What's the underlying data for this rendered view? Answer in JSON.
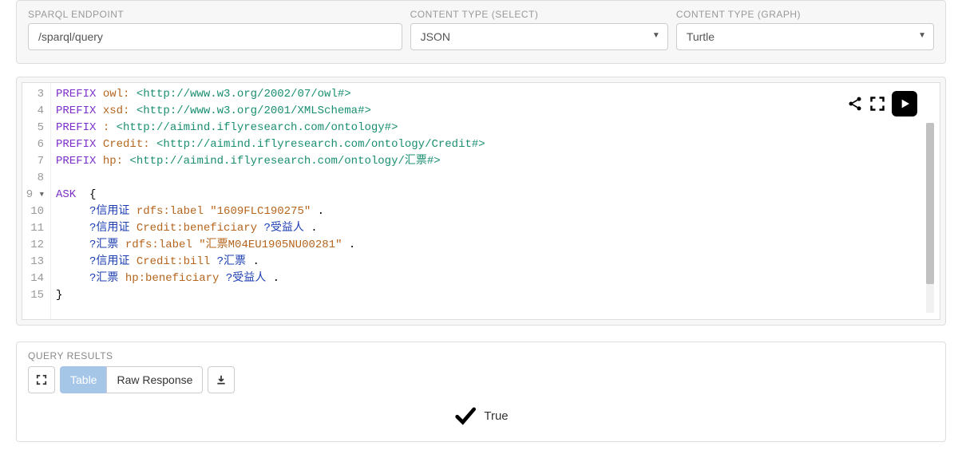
{
  "config": {
    "endpoint": {
      "label": "SPARQL ENDPOINT",
      "value": "/sparql/query"
    },
    "selectType": {
      "label": "CONTENT TYPE (SELECT)",
      "value": "JSON"
    },
    "graphType": {
      "label": "CONTENT TYPE (GRAPH)",
      "value": "Turtle"
    }
  },
  "editor": {
    "startLine": 3,
    "foldLine": 9,
    "lines": [
      [
        {
          "t": "PREFIX ",
          "c": "kw"
        },
        {
          "t": "owl:",
          "c": "pfx"
        },
        {
          "t": " <http://www.w3.org/2002/07/owl#>",
          "c": "uri"
        }
      ],
      [
        {
          "t": "PREFIX ",
          "c": "kw"
        },
        {
          "t": "xsd:",
          "c": "pfx"
        },
        {
          "t": " <http://www.w3.org/2001/XMLSchema#>",
          "c": "uri"
        }
      ],
      [
        {
          "t": "PREFIX ",
          "c": "kw"
        },
        {
          "t": ":",
          "c": "pfx"
        },
        {
          "t": " <http://aimind.iflyresearch.com/ontology#>",
          "c": "uri"
        }
      ],
      [
        {
          "t": "PREFIX ",
          "c": "kw"
        },
        {
          "t": "Credit:",
          "c": "pfx"
        },
        {
          "t": " <http://aimind.iflyresearch.com/ontology/Credit#>",
          "c": "uri"
        }
      ],
      [
        {
          "t": "PREFIX ",
          "c": "kw"
        },
        {
          "t": "hp:",
          "c": "pfx"
        },
        {
          "t": " <http://aimind.iflyresearch.com/ontology/汇票#>",
          "c": "uri"
        }
      ],
      [
        {
          "t": "",
          "c": "punct"
        }
      ],
      [
        {
          "t": "ASK",
          "c": "kw"
        },
        {
          "t": "  {",
          "c": "punct"
        }
      ],
      [
        {
          "t": "     ",
          "c": "punct"
        },
        {
          "t": "?信用证",
          "c": "var"
        },
        {
          "t": " ",
          "c": "punct"
        },
        {
          "t": "rdfs:label",
          "c": "pfx"
        },
        {
          "t": " ",
          "c": "punct"
        },
        {
          "t": "\"1609FLC190275\"",
          "c": "str"
        },
        {
          "t": " .",
          "c": "punct"
        }
      ],
      [
        {
          "t": "     ",
          "c": "punct"
        },
        {
          "t": "?信用证",
          "c": "var"
        },
        {
          "t": " ",
          "c": "punct"
        },
        {
          "t": "Credit:beneficiary",
          "c": "pfx"
        },
        {
          "t": " ",
          "c": "punct"
        },
        {
          "t": "?受益人",
          "c": "var"
        },
        {
          "t": " .",
          "c": "punct"
        }
      ],
      [
        {
          "t": "     ",
          "c": "punct"
        },
        {
          "t": "?汇票",
          "c": "var"
        },
        {
          "t": " ",
          "c": "punct"
        },
        {
          "t": "rdfs:label",
          "c": "pfx"
        },
        {
          "t": " ",
          "c": "punct"
        },
        {
          "t": "\"汇票M04EU1905NU00281\"",
          "c": "str"
        },
        {
          "t": " .",
          "c": "punct"
        }
      ],
      [
        {
          "t": "     ",
          "c": "punct"
        },
        {
          "t": "?信用证",
          "c": "var"
        },
        {
          "t": " ",
          "c": "punct"
        },
        {
          "t": "Credit:bill",
          "c": "pfx"
        },
        {
          "t": " ",
          "c": "punct"
        },
        {
          "t": "?汇票",
          "c": "var"
        },
        {
          "t": " .",
          "c": "punct"
        }
      ],
      [
        {
          "t": "     ",
          "c": "punct"
        },
        {
          "t": "?汇票",
          "c": "var"
        },
        {
          "t": " ",
          "c": "punct"
        },
        {
          "t": "hp:beneficiary",
          "c": "pfx"
        },
        {
          "t": " ",
          "c": "punct"
        },
        {
          "t": "?受益人",
          "c": "var"
        },
        {
          "t": " .",
          "c": "punct"
        }
      ],
      [
        {
          "t": "}",
          "c": "punct"
        }
      ]
    ]
  },
  "results": {
    "header": "QUERY RESULTS",
    "tabs": {
      "table": "Table",
      "raw": "Raw Response"
    },
    "value": "True"
  }
}
